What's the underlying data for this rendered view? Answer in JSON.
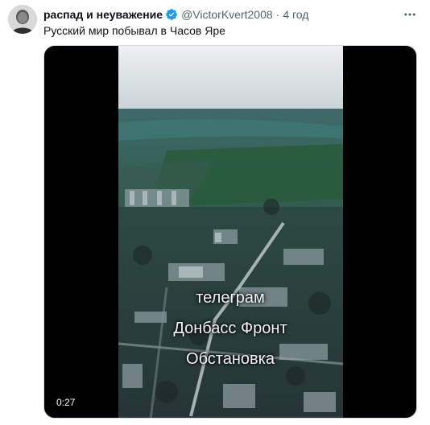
{
  "author": {
    "display_name": "распад и неуважение",
    "handle": "@VictorKvert2008",
    "time": "4 год",
    "verified": true,
    "avatar_icon": "user-avatar"
  },
  "tweet": {
    "text": "Русский мир побывал в Часов Яре"
  },
  "media": {
    "type": "video",
    "duration": "0:27",
    "overlay_lines": [
      "телеграм",
      "Донбасс Фронт",
      "Обстановка"
    ]
  },
  "colors": {
    "verified_badge": "#1d9bf0",
    "secondary_text": "#536471",
    "primary_text": "#0f1419"
  }
}
